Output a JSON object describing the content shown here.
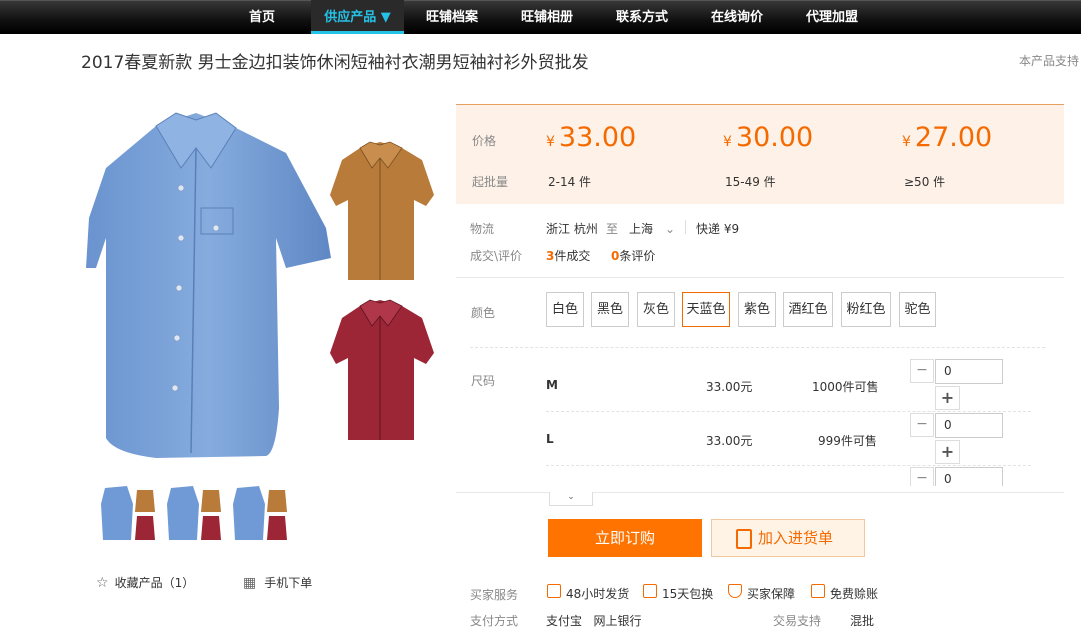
{
  "nav": {
    "items": [
      {
        "label": "首页"
      },
      {
        "label": "供应产品 ▼",
        "active": true
      },
      {
        "label": "旺铺档案"
      },
      {
        "label": "旺铺相册"
      },
      {
        "label": "联系方式"
      },
      {
        "label": "在线询价"
      },
      {
        "label": "代理加盟"
      }
    ]
  },
  "product": {
    "title": "2017春夏新款 男士金边扣装饰休闲短袖衬衣潮男短袖衬衫外贸批发",
    "title_right": "本产品支持"
  },
  "gallery": {
    "actions": {
      "favorite": "收藏产品（1）",
      "mobile_order": "手机下单"
    },
    "colors": {
      "blue": "#6f9ad6",
      "tan": "#b87b3a",
      "red": "#9c2536"
    }
  },
  "price": {
    "price_label": "价格",
    "qty_label": "起批量",
    "tiers": [
      {
        "yen": "¥",
        "price": "33.00",
        "qty": "2-14 件"
      },
      {
        "yen": "¥",
        "price": "30.00",
        "qty": "15-49 件"
      },
      {
        "yen": "¥",
        "price": "27.00",
        "qty": "≥50 件"
      }
    ]
  },
  "logistics": {
    "label": "物流",
    "from": "浙江 杭州",
    "to_word": "至",
    "to": "上海",
    "shipping": "快递 ¥9"
  },
  "deals": {
    "label": "成交\\评价",
    "count": "3",
    "count_suffix": "件成交",
    "reviews": "0",
    "reviews_suffix": "条评价"
  },
  "color_options": {
    "label": "颜色",
    "options": [
      "白色",
      "黑色",
      "灰色",
      "天蓝色",
      "紫色",
      "酒红色",
      "粉红色",
      "驼色"
    ],
    "selected": "天蓝色"
  },
  "sizes": {
    "label": "尺码",
    "rows": [
      {
        "size": "M",
        "price": "33.00元",
        "stock": "1000件可售",
        "quantity": "0"
      },
      {
        "size": "L",
        "price": "33.00元",
        "stock": "999件可售",
        "quantity": "0"
      },
      {
        "size": "",
        "price": "",
        "stock": "",
        "quantity": "0"
      }
    ],
    "minus": "−",
    "plus": "+",
    "expand": "⌄"
  },
  "buttons": {
    "buy": "立即订购",
    "cart": "加入进货单"
  },
  "services": {
    "label": "买家服务",
    "items": [
      "48小时发货",
      "15天包换",
      "买家保障",
      "免费赊账"
    ]
  },
  "payment": {
    "label": "支付方式",
    "methods": "支付宝   网上银行",
    "trade_label": "交易支持",
    "trade_value": "混批"
  }
}
